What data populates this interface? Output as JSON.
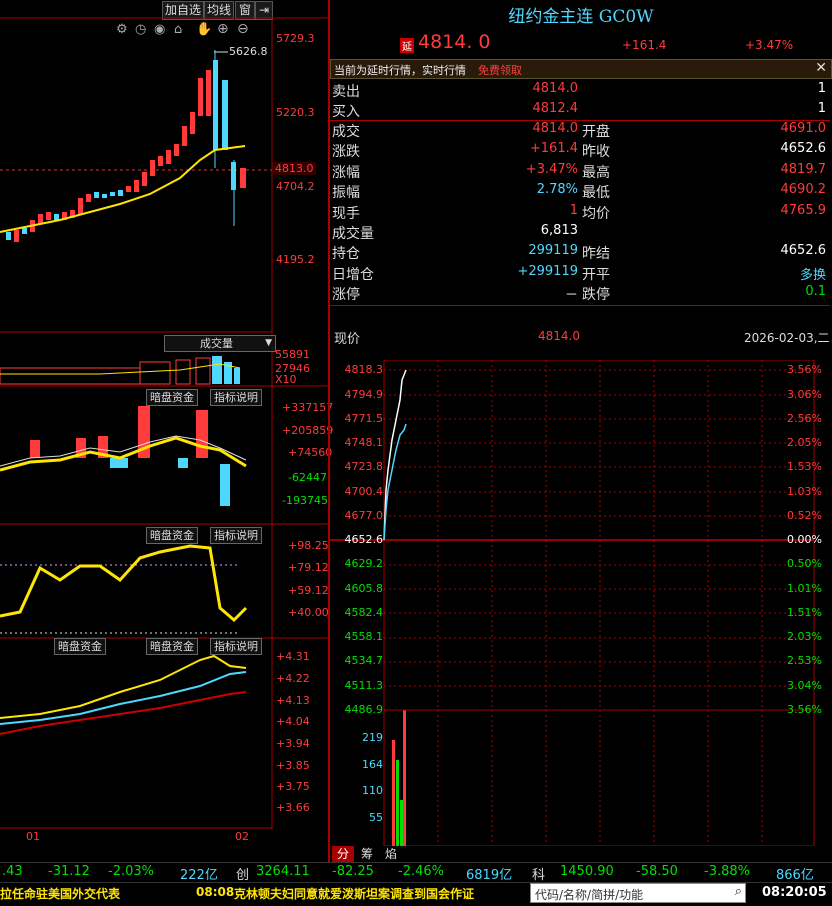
{
  "toolbar": {
    "add_fav": "加自选",
    "avg_line": "均线",
    "window": "窗"
  },
  "main_chart": {
    "price_labels": [
      "5729.3",
      "5220.3",
      "4813.0",
      "4704.2",
      "4195.2"
    ],
    "high_label": "5626.8",
    "volume_dropdown": "成交量",
    "volume_labels": [
      "55891",
      "27946",
      "X10"
    ],
    "x_labels": [
      "01",
      "02"
    ]
  },
  "panels": {
    "dark_pool_btn": "暗盘资金",
    "indicator_btn": "指标说明",
    "panel1_labels": [
      "+337157",
      "+205859",
      "+74560",
      "-62447",
      "-193745"
    ],
    "panel2_labels": [
      "+98.25",
      "+79.12",
      "+59.12",
      "+40.00"
    ],
    "panel3_labels": [
      "+4.31",
      "+4.22",
      "+4.13",
      "+4.04",
      "+3.94",
      "+3.85",
      "+3.75",
      "+3.66"
    ]
  },
  "quote": {
    "title": "纽约金主连 GC0W",
    "delay_badge": "延",
    "price": "4814. 0",
    "change": "+161.4",
    "change_pct": "+3.47%",
    "notice": "当前为延时行情，实时行情",
    "notice_link": "免费领取",
    "ask_label": "卖出",
    "ask_price": "4814.0",
    "ask_vol": "1",
    "bid_label": "买入",
    "bid_price": "4812.4",
    "bid_vol": "1",
    "rows": [
      {
        "l1": "成交",
        "v1": "4814.0",
        "c1": "red",
        "l2": "开盘",
        "v2": "4691.0",
        "c2": "red"
      },
      {
        "l1": "涨跌",
        "v1": "+161.4",
        "c1": "red",
        "l2": "昨收",
        "v2": "4652.6",
        "c2": "white"
      },
      {
        "l1": "涨幅",
        "v1": "+3.47%",
        "c1": "red",
        "l2": "最高",
        "v2": "4819.7",
        "c2": "red"
      },
      {
        "l1": "振幅",
        "v1": "2.78%",
        "c1": "cyan",
        "l2": "最低",
        "v2": "4690.2",
        "c2": "red"
      },
      {
        "l1": "现手",
        "v1": "1",
        "c1": "red",
        "l2": "均价",
        "v2": "4765.9",
        "c2": "red"
      },
      {
        "l1": "成交量",
        "v1": "6,813",
        "c1": "white",
        "l2": "",
        "v2": "",
        "c2": "white"
      },
      {
        "l1": "持仓",
        "v1": "299119",
        "c1": "cyan",
        "l2": "昨结",
        "v2": "4652.6",
        "c2": "white"
      },
      {
        "l1": "日增仓",
        "v1": "+299119",
        "c1": "cyan",
        "l2": "开平",
        "v2": "多换",
        "c2": "cyan"
      },
      {
        "l1": "涨停",
        "v1": "－",
        "c1": "white",
        "l2": "跌停",
        "v2": "0.1",
        "c2": "green"
      }
    ]
  },
  "intraday": {
    "price_label": "现价",
    "price_value": "4814.0",
    "date": "2026-02-03,二",
    "left_axis": [
      "4818.3",
      "4794.9",
      "4771.5",
      "4748.1",
      "4723.8",
      "4700.4",
      "4677.0",
      "4652.6",
      "4629.2",
      "4605.8",
      "4582.4",
      "4558.1",
      "4534.7",
      "4511.3",
      "4486.9"
    ],
    "right_axis": [
      "3.56%",
      "3.06%",
      "2.56%",
      "2.05%",
      "1.53%",
      "1.03%",
      "0.52%",
      "0.00%",
      "0.50%",
      "1.01%",
      "1.51%",
      "2.03%",
      "2.53%",
      "3.04%",
      "3.56%"
    ],
    "vol_axis": [
      "219",
      "164",
      "110",
      "55"
    ],
    "tabs": [
      "分",
      "筹",
      "焰"
    ]
  },
  "ticker": {
    "left_items": [
      ".43",
      "-31.12",
      "-2.03%",
      "222亿"
    ],
    "chuang": "创",
    "chuang_val": "3264.11",
    "chuang_chg": "-82.25",
    "chuang_pct": "-2.46%",
    "chuang_amt": "6819亿",
    "ke": "科",
    "ke_val": "1450.90",
    "ke_chg": "-58.50",
    "ke_pct": "-3.88%",
    "ke_amt": "866亿"
  },
  "news": {
    "left": "拉任命驻美国外交代表",
    "time": "08:08",
    "text": "克林顿夫妇同意就爱泼斯坦案调查到国会作证",
    "search_placeholder": "代码/名称/简拼/功能",
    "clock": "08:20:05"
  }
}
